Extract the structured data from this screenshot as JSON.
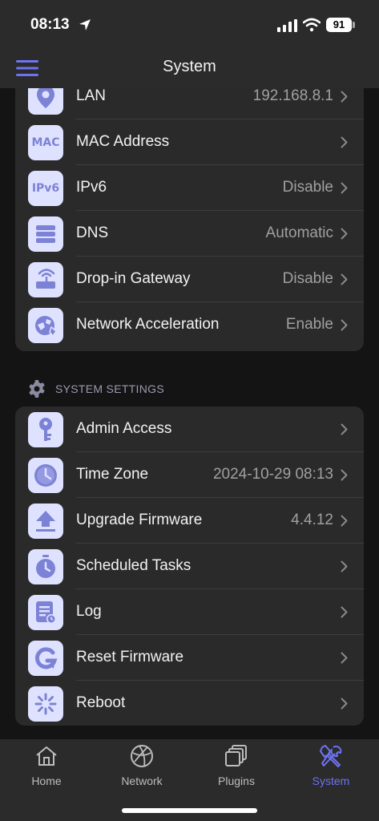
{
  "status_bar": {
    "time": "08:13",
    "battery": "91"
  },
  "header": {
    "title": "System"
  },
  "network_rows": [
    {
      "label": "LAN",
      "value": "192.168.8.1",
      "icon": "location-pin-icon"
    },
    {
      "label": "MAC Address",
      "value": "",
      "icon_text": "MAC",
      "icon": "mac-icon"
    },
    {
      "label": "IPv6",
      "value": "Disable",
      "icon_text": "IPv6",
      "icon": "ipv6-icon"
    },
    {
      "label": "DNS",
      "value": "Automatic",
      "icon": "server-icon"
    },
    {
      "label": "Drop-in Gateway",
      "value": "Disable",
      "icon": "router-icon"
    },
    {
      "label": "Network Acceleration",
      "value": "Enable",
      "icon": "acceleration-icon"
    }
  ],
  "system_settings": {
    "title": "SYSTEM SETTINGS",
    "rows": [
      {
        "label": "Admin Access",
        "value": "",
        "icon": "key-icon"
      },
      {
        "label": "Time Zone",
        "value": "2024-10-29 08:13",
        "icon": "clock-icon"
      },
      {
        "label": "Upgrade Firmware",
        "value": "4.4.12",
        "icon": "upload-icon"
      },
      {
        "label": "Scheduled Tasks",
        "value": "",
        "icon": "stopwatch-icon"
      },
      {
        "label": "Log",
        "value": "",
        "icon": "log-icon"
      },
      {
        "label": "Reset Firmware",
        "value": "",
        "icon": "reset-icon"
      },
      {
        "label": "Reboot",
        "value": "",
        "icon": "reboot-icon"
      }
    ]
  },
  "tabs": [
    {
      "label": "Home",
      "icon": "home-icon",
      "active": false
    },
    {
      "label": "Network",
      "icon": "globe-icon",
      "active": false
    },
    {
      "label": "Plugins",
      "icon": "plugins-icon",
      "active": false
    },
    {
      "label": "System",
      "icon": "tools-icon",
      "active": true
    }
  ],
  "colors": {
    "accent": "#6d74f2",
    "icon_bg": "#dfe2ff",
    "icon_fg": "#7c82d6",
    "background": "#141414",
    "card": "#2a2a2a"
  }
}
